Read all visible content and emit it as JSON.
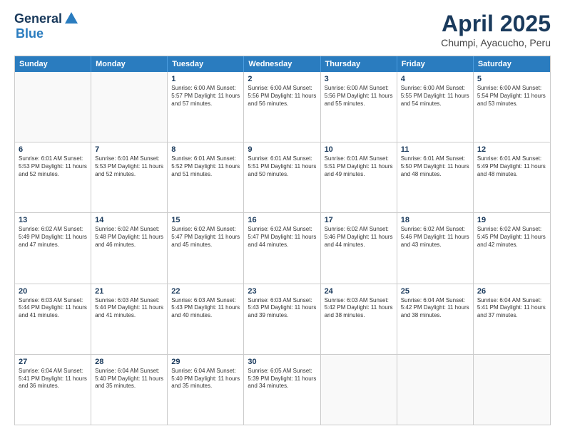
{
  "header": {
    "logo_general": "General",
    "logo_blue": "Blue",
    "main_title": "April 2025",
    "subtitle": "Chumpi, Ayacucho, Peru"
  },
  "weekdays": [
    "Sunday",
    "Monday",
    "Tuesday",
    "Wednesday",
    "Thursday",
    "Friday",
    "Saturday"
  ],
  "rows": [
    [
      {
        "day": "",
        "info": ""
      },
      {
        "day": "",
        "info": ""
      },
      {
        "day": "1",
        "info": "Sunrise: 6:00 AM\nSunset: 5:57 PM\nDaylight: 11 hours and 57 minutes."
      },
      {
        "day": "2",
        "info": "Sunrise: 6:00 AM\nSunset: 5:56 PM\nDaylight: 11 hours and 56 minutes."
      },
      {
        "day": "3",
        "info": "Sunrise: 6:00 AM\nSunset: 5:56 PM\nDaylight: 11 hours and 55 minutes."
      },
      {
        "day": "4",
        "info": "Sunrise: 6:00 AM\nSunset: 5:55 PM\nDaylight: 11 hours and 54 minutes."
      },
      {
        "day": "5",
        "info": "Sunrise: 6:00 AM\nSunset: 5:54 PM\nDaylight: 11 hours and 53 minutes."
      }
    ],
    [
      {
        "day": "6",
        "info": "Sunrise: 6:01 AM\nSunset: 5:53 PM\nDaylight: 11 hours and 52 minutes."
      },
      {
        "day": "7",
        "info": "Sunrise: 6:01 AM\nSunset: 5:53 PM\nDaylight: 11 hours and 52 minutes."
      },
      {
        "day": "8",
        "info": "Sunrise: 6:01 AM\nSunset: 5:52 PM\nDaylight: 11 hours and 51 minutes."
      },
      {
        "day": "9",
        "info": "Sunrise: 6:01 AM\nSunset: 5:51 PM\nDaylight: 11 hours and 50 minutes."
      },
      {
        "day": "10",
        "info": "Sunrise: 6:01 AM\nSunset: 5:51 PM\nDaylight: 11 hours and 49 minutes."
      },
      {
        "day": "11",
        "info": "Sunrise: 6:01 AM\nSunset: 5:50 PM\nDaylight: 11 hours and 48 minutes."
      },
      {
        "day": "12",
        "info": "Sunrise: 6:01 AM\nSunset: 5:49 PM\nDaylight: 11 hours and 48 minutes."
      }
    ],
    [
      {
        "day": "13",
        "info": "Sunrise: 6:02 AM\nSunset: 5:49 PM\nDaylight: 11 hours and 47 minutes."
      },
      {
        "day": "14",
        "info": "Sunrise: 6:02 AM\nSunset: 5:48 PM\nDaylight: 11 hours and 46 minutes."
      },
      {
        "day": "15",
        "info": "Sunrise: 6:02 AM\nSunset: 5:47 PM\nDaylight: 11 hours and 45 minutes."
      },
      {
        "day": "16",
        "info": "Sunrise: 6:02 AM\nSunset: 5:47 PM\nDaylight: 11 hours and 44 minutes."
      },
      {
        "day": "17",
        "info": "Sunrise: 6:02 AM\nSunset: 5:46 PM\nDaylight: 11 hours and 44 minutes."
      },
      {
        "day": "18",
        "info": "Sunrise: 6:02 AM\nSunset: 5:46 PM\nDaylight: 11 hours and 43 minutes."
      },
      {
        "day": "19",
        "info": "Sunrise: 6:02 AM\nSunset: 5:45 PM\nDaylight: 11 hours and 42 minutes."
      }
    ],
    [
      {
        "day": "20",
        "info": "Sunrise: 6:03 AM\nSunset: 5:44 PM\nDaylight: 11 hours and 41 minutes."
      },
      {
        "day": "21",
        "info": "Sunrise: 6:03 AM\nSunset: 5:44 PM\nDaylight: 11 hours and 41 minutes."
      },
      {
        "day": "22",
        "info": "Sunrise: 6:03 AM\nSunset: 5:43 PM\nDaylight: 11 hours and 40 minutes."
      },
      {
        "day": "23",
        "info": "Sunrise: 6:03 AM\nSunset: 5:43 PM\nDaylight: 11 hours and 39 minutes."
      },
      {
        "day": "24",
        "info": "Sunrise: 6:03 AM\nSunset: 5:42 PM\nDaylight: 11 hours and 38 minutes."
      },
      {
        "day": "25",
        "info": "Sunrise: 6:04 AM\nSunset: 5:42 PM\nDaylight: 11 hours and 38 minutes."
      },
      {
        "day": "26",
        "info": "Sunrise: 6:04 AM\nSunset: 5:41 PM\nDaylight: 11 hours and 37 minutes."
      }
    ],
    [
      {
        "day": "27",
        "info": "Sunrise: 6:04 AM\nSunset: 5:41 PM\nDaylight: 11 hours and 36 minutes."
      },
      {
        "day": "28",
        "info": "Sunrise: 6:04 AM\nSunset: 5:40 PM\nDaylight: 11 hours and 35 minutes."
      },
      {
        "day": "29",
        "info": "Sunrise: 6:04 AM\nSunset: 5:40 PM\nDaylight: 11 hours and 35 minutes."
      },
      {
        "day": "30",
        "info": "Sunrise: 6:05 AM\nSunset: 5:39 PM\nDaylight: 11 hours and 34 minutes."
      },
      {
        "day": "",
        "info": ""
      },
      {
        "day": "",
        "info": ""
      },
      {
        "day": "",
        "info": ""
      }
    ]
  ]
}
